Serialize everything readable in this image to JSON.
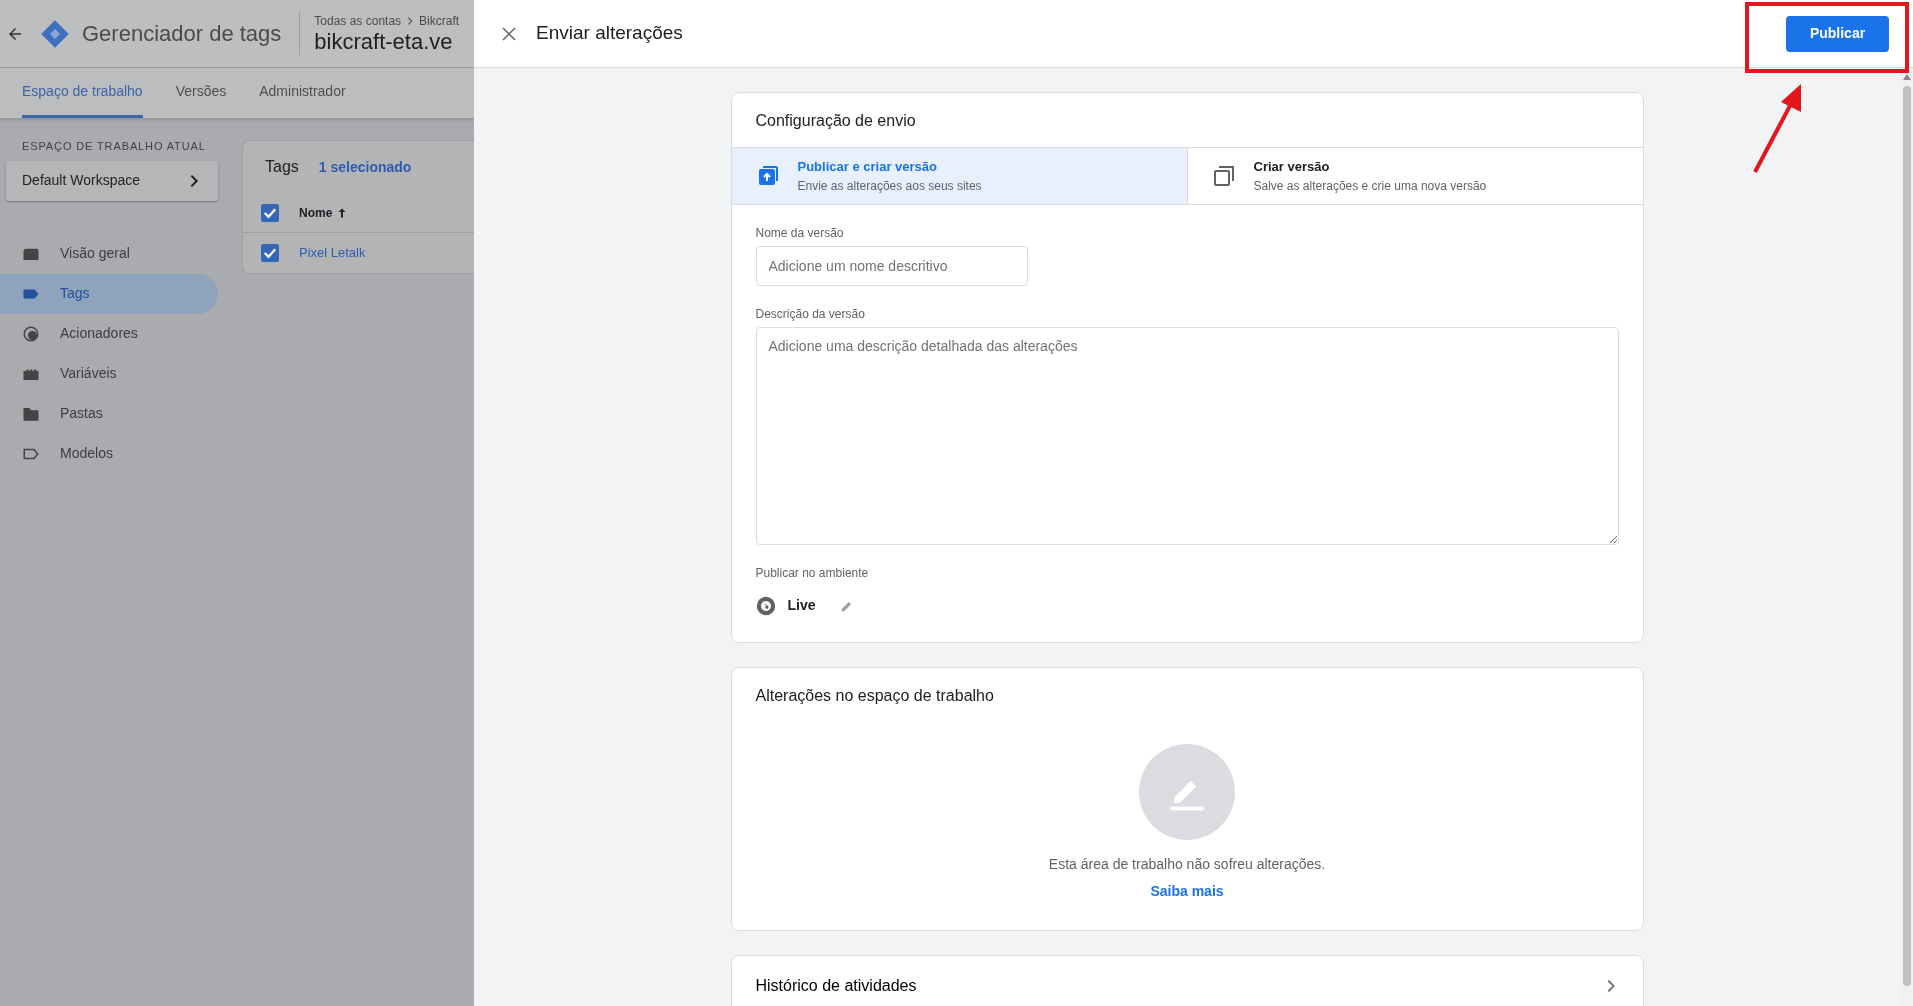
{
  "app": {
    "title": "Gerenciador de tags",
    "breadcrumb": [
      "Todas as contas",
      "Bikcraft"
    ],
    "container": "bikcraft-eta.ve"
  },
  "nav_tabs": [
    {
      "label": "Espaço de trabalho",
      "selected": true
    },
    {
      "label": "Versões",
      "selected": false
    },
    {
      "label": "Administrador",
      "selected": false
    }
  ],
  "workspace": {
    "heading": "ESPAÇO DE TRABALHO ATUAL",
    "name": "Default Workspace"
  },
  "sidebar": {
    "items": [
      {
        "label": "Visão geral",
        "selected": false
      },
      {
        "label": "Tags",
        "selected": true
      },
      {
        "label": "Acionadores",
        "selected": false
      },
      {
        "label": "Variáveis",
        "selected": false
      },
      {
        "label": "Pastas",
        "selected": false
      },
      {
        "label": "Modelos",
        "selected": false
      }
    ]
  },
  "tags_panel": {
    "title": "Tags",
    "selection": "1 selecionado",
    "header": {
      "label": "Nome",
      "checked": true
    },
    "rows": [
      {
        "name": "Pixel Letalk",
        "checked": true
      }
    ]
  },
  "dialog": {
    "title": "Enviar alterações",
    "publish_button": {
      "label": "Publicar",
      "highlighted": true
    }
  },
  "config_card": {
    "title": "Configuração de envio",
    "options": [
      {
        "title": "Publicar e criar versão",
        "subtitle": "Envie as alterações aos seus sites",
        "selected": true
      },
      {
        "title": "Criar versão",
        "subtitle": "Salve as alterações e crie uma nova versão",
        "selected": false
      }
    ],
    "fields": [
      {
        "kind": "input",
        "label": "Nome da versão",
        "placeholder": "Adicione um nome descritivo"
      },
      {
        "kind": "textarea",
        "label": "Descrição da versão",
        "placeholder": "Adicione uma descrição detalhada das alterações"
      }
    ],
    "environment": {
      "label": "Publicar no ambiente",
      "name": "Live"
    }
  },
  "changes_card": {
    "title": "Alterações no espaço de trabalho",
    "empty_message": "Esta área de trabalho não sofreu alterações.",
    "link": "Saiba mais"
  },
  "history": {
    "title": "Histórico de atividades"
  }
}
